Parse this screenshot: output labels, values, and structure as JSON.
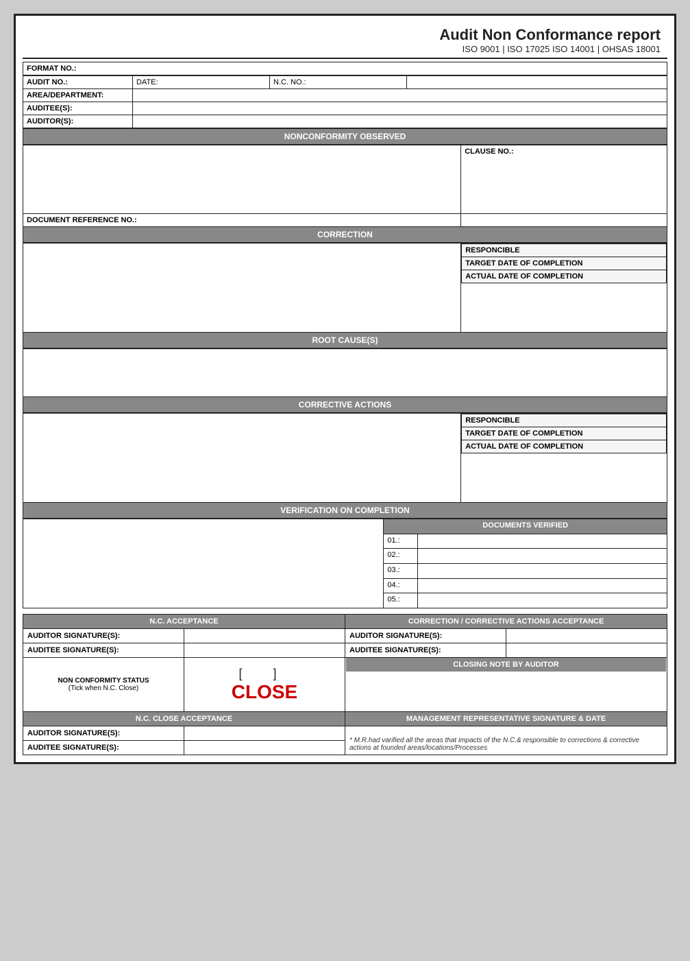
{
  "header": {
    "title": "Audit Non Conformance report",
    "subtitle": "ISO 9001 | ISO 17025 ISO 14001 | OHSAS 18001"
  },
  "format_no_label": "FORMAT NO.:",
  "info_rows": {
    "audit_no_label": "AUDIT NO.:",
    "date_label": "DATE:",
    "nc_no_label": "N.C. NO.:",
    "area_dept_label": "AREA/DEPARTMENT:",
    "auditees_label": "AUDITEE(S):",
    "auditors_label": "AUDITOR(S):"
  },
  "sections": {
    "nonconformity": "NONCONFORMITY OBSERVED",
    "clause_no": "CLAUSE NO.:",
    "doc_ref": "DOCUMENT REFERENCE NO.:",
    "correction": "CORRECTION",
    "responcible": "RESPONCIBLE",
    "target_date": "TARGET DATE OF COMPLETION",
    "actual_date": "ACTUAL DATE OF COMPLETION",
    "root_cause": "ROOT CAUSE(S)",
    "corrective_actions": "CORRECTIVE ACTIONS",
    "verification": "VERIFICATION ON COMPLETION",
    "docs_verified": "DOCUMENTS VERIFIED"
  },
  "verification_items": [
    "01.:",
    "02.:",
    "03.:",
    "04.:",
    "05.:"
  ],
  "acceptance": {
    "nc_acceptance": "N.C. ACCEPTANCE",
    "correction_acceptance": "CORRECTION / CORRECTIVE ACTIONS ACCEPTANCE",
    "auditor_sig_label": "AUDITOR SIGNATURE(S):",
    "auditee_sig_label": "AUDITEE SIGNATURE(S):",
    "non_conf_status_label": "NON CONFORMITY STATUS",
    "tick_label": "(Tick when N.C. Close)",
    "close_brackets": "[          ]",
    "close_text": "CLOSE",
    "closing_note_label": "CLOSING NOTE BY AUDITOR",
    "nc_close_acceptance": "N.C. CLOSE ACCEPTANCE",
    "mgmt_rep_label": "MANAGEMENT REPRESENTATIVE SIGNATURE & DATE",
    "footnote": "* M.R.had varified all the areas that impacts of the N.C.& responsible to corrections & corrective actions at founded areas/locations/Processes"
  }
}
